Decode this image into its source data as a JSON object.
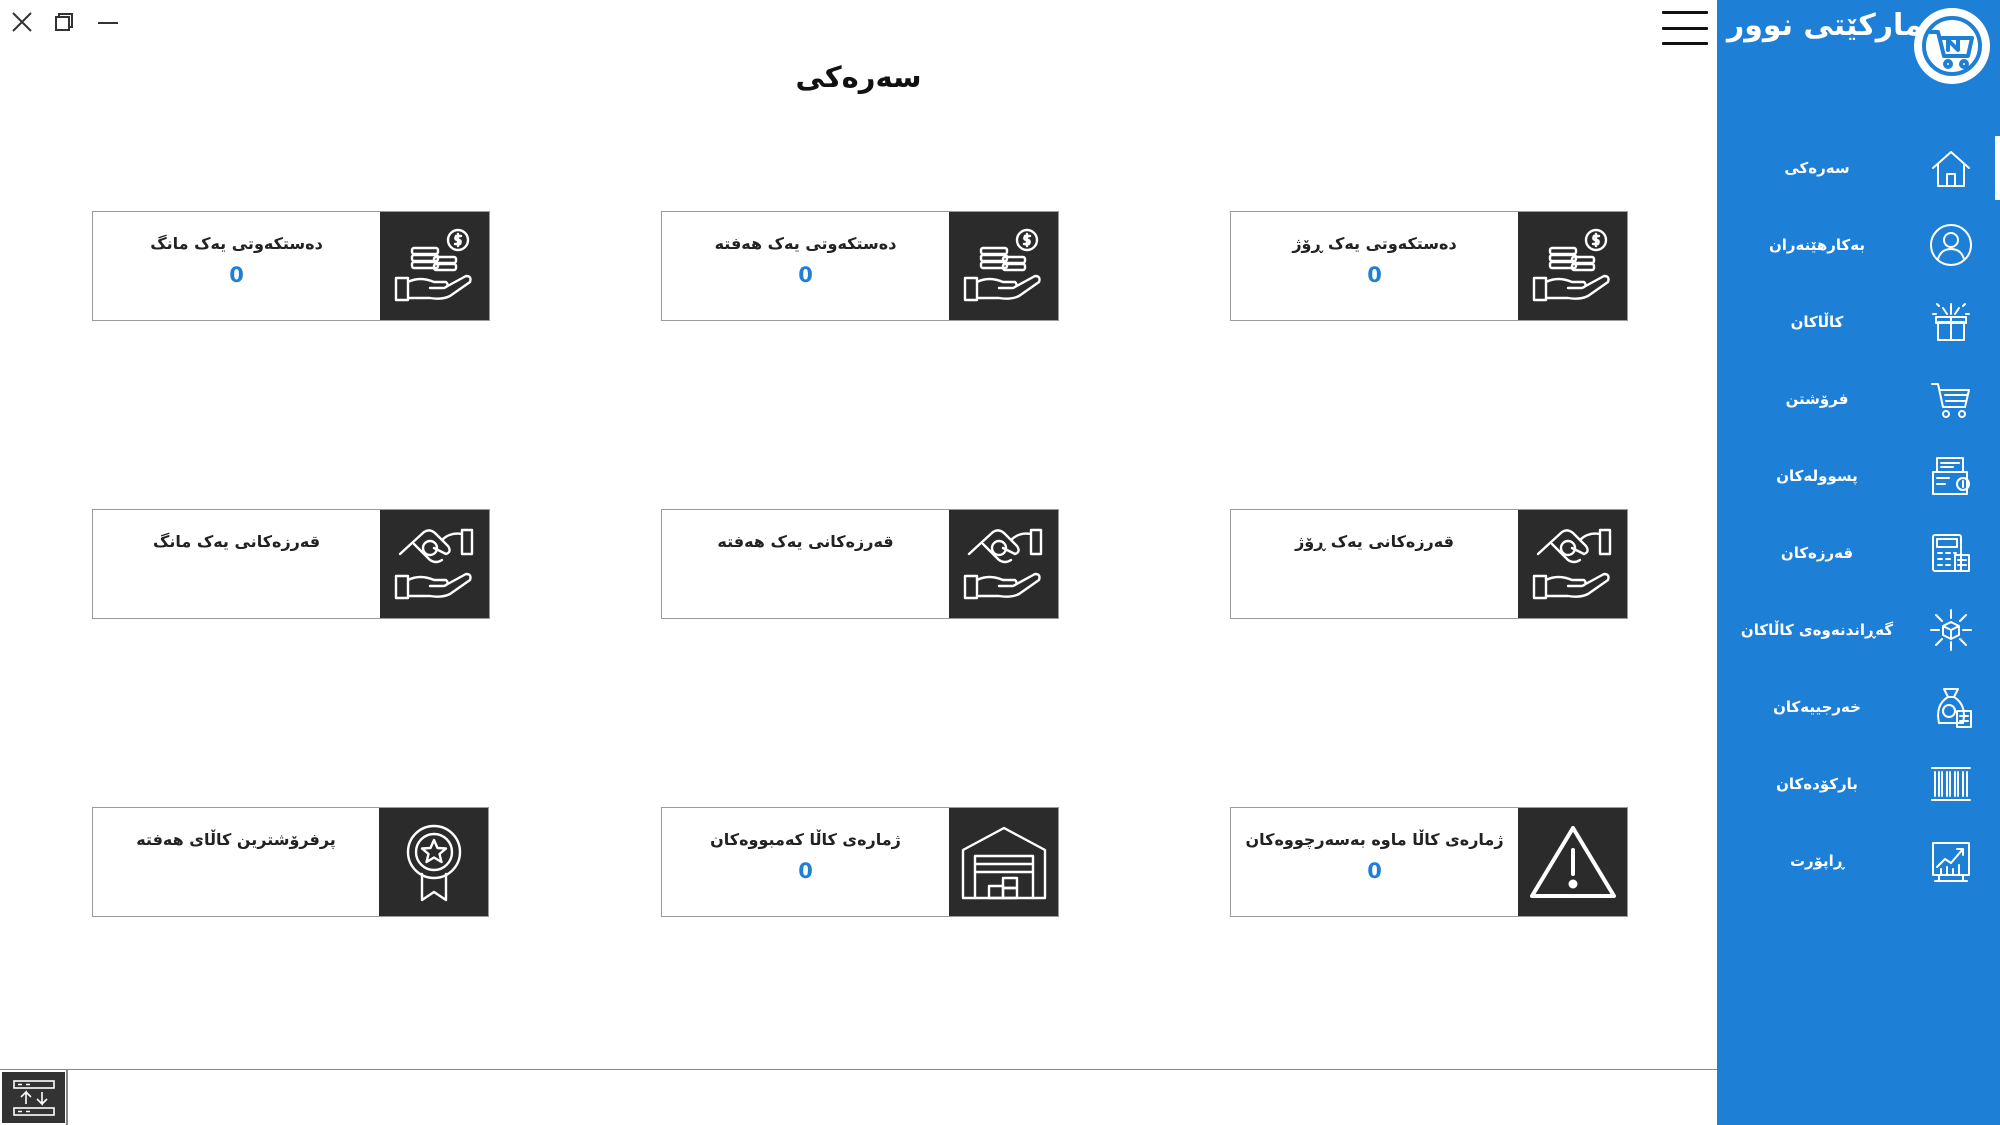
{
  "window": {
    "close_icon": "close-icon",
    "restore_icon": "restore-icon",
    "minimize_icon": "minimize-icon"
  },
  "page": {
    "title": "سەرەکی"
  },
  "brand": {
    "name": "مارکێتی نوور",
    "logo_icon": "cart-logo-icon"
  },
  "cards": [
    {
      "label": "دەستکەوتی یەک ڕۆژ",
      "value": "0",
      "icon": "money-hand-icon"
    },
    {
      "label": "دەستکەوتی یەک هەفتە",
      "value": "0",
      "icon": "money-hand-icon"
    },
    {
      "label": "دەستکەوتی یەک مانگ",
      "value": "0",
      "icon": "money-hand-icon"
    },
    {
      "label": "قەرزەکانی یەک ڕۆژ",
      "value": "",
      "icon": "debt-hand-icon"
    },
    {
      "label": "قەرزەکانی یەک هەفتە",
      "value": "",
      "icon": "debt-hand-icon"
    },
    {
      "label": "قەرزەکانی یەک مانگ",
      "value": "",
      "icon": "debt-hand-icon"
    },
    {
      "label": "ژمارەی کاڵا ماوە بەسەرچووەکان",
      "value": "0",
      "icon": "warning-icon"
    },
    {
      "label": "ژمارەی کاڵا کەمبووەکان",
      "value": "0",
      "icon": "warehouse-icon"
    },
    {
      "label": "پرفرۆشترین کاڵای هەفتە",
      "value": "",
      "icon": "award-badge-icon"
    }
  ],
  "sidebar": {
    "items": [
      {
        "label": "سەرەکی",
        "icon": "home-icon",
        "active": true
      },
      {
        "label": "بەکارهێنەران",
        "icon": "user-icon"
      },
      {
        "label": "کاڵاکان",
        "icon": "gift-box-icon"
      },
      {
        "label": "فرۆشتن",
        "icon": "cart-icon"
      },
      {
        "label": "پسوولەکان",
        "icon": "receipt-icon"
      },
      {
        "label": "قەرزەکان",
        "icon": "calculator-icon"
      },
      {
        "label": "گەڕاندنەوەی کاڵاکان",
        "icon": "return-box-icon"
      },
      {
        "label": "خەرجییەکان",
        "icon": "money-bag-icon"
      },
      {
        "label": "بارکۆدەکان",
        "icon": "barcode-icon"
      },
      {
        "label": "ڕاپۆرت",
        "icon": "chart-icon"
      }
    ]
  },
  "bottom": {
    "button_icon": "server-sync-icon"
  },
  "colors": {
    "sidebar": "#1e7fd6",
    "card_icon_bg": "#2b2b2b",
    "value_text": "#1e7fd6"
  }
}
